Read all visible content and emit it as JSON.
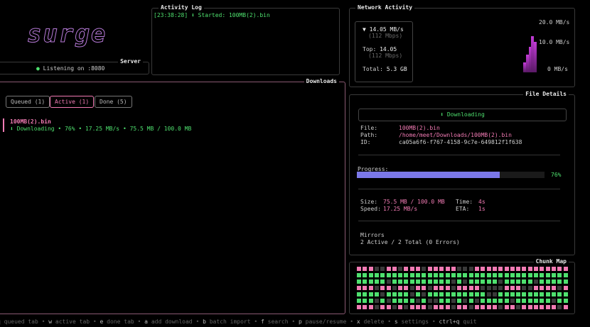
{
  "logo": {
    "text": "surge"
  },
  "server": {
    "title": "Server",
    "status": "Listening on :8080",
    "status_color": "#4ee06e"
  },
  "activity": {
    "title": "Activity Log",
    "entries": [
      {
        "time": "[23:38:28]",
        "message": "⬇ Started: 100MB(2).bin"
      }
    ]
  },
  "network": {
    "title": "Network Activity",
    "current_speed": "▼ 14.05 MB/s",
    "current_mbps": "(112 Mbps)",
    "top_label": "Top:",
    "top_value": "14.05",
    "top_mbps": "(112 Mbps)",
    "total_label": "Total:",
    "total_value": "5.3 GB",
    "axis": [
      "20.0 MB/s",
      "10.0 MB/s",
      "0 MB/s"
    ]
  },
  "chart_data": {
    "type": "area",
    "ylim": [
      0,
      20
    ],
    "y_unit": "MB/s",
    "values": [
      0,
      0,
      0,
      0,
      0,
      0,
      0,
      0,
      0,
      0,
      0,
      0,
      0,
      0,
      0,
      0,
      0,
      0,
      0,
      0,
      0,
      0,
      0,
      0,
      0,
      0,
      0,
      0,
      0,
      0,
      0,
      0,
      0,
      0,
      0,
      0,
      0,
      0,
      0,
      0,
      4,
      7,
      10,
      14.05,
      12
    ]
  },
  "downloads": {
    "title": "Downloads",
    "tabs": [
      {
        "label": "Queued (1)",
        "active": false
      },
      {
        "label": "Active (1)",
        "active": true
      },
      {
        "label": "Done (5)",
        "active": false
      }
    ],
    "items": [
      {
        "name": "100MB(2).bin",
        "status": "⬇ Downloading • 76% • 17.25 MB/s • 75.5 MB / 100.0 MB"
      }
    ]
  },
  "details": {
    "title": "File Details",
    "status": "⬇ Downloading",
    "file_label": "File:",
    "file": "100MB(2).bin",
    "path_label": "Path:",
    "path": "/home/meet/Downloads/100MB(2).bin",
    "id_label": "ID:",
    "id": "ca05a6f6-f767-4158-9c7e-649812f1f638",
    "progress_label": "Progress:",
    "progress": 0.76,
    "progress_text": "76%",
    "size_label": "Size:",
    "size": "75.5 MB / 100.0 MB",
    "time_label": "Time:",
    "time": "4s",
    "speed_label": "Speed:",
    "speed": "17.25 MB/s",
    "eta_label": "ETA:",
    "eta": "1s",
    "mirrors_label": "Mirrors",
    "mirrors": "2 Active / 2 Total (0 Errors)"
  },
  "chunkmap": {
    "title": "Chunk Map",
    "colors": {
      "done": "#4ee06e",
      "active": "#f27bb4",
      "pending": "#3a3a3a"
    },
    "rows": [
      "ppp..pp.ppp.ppppp...pppppppppppppppp",
      "gggggggggggggggggggggggggggggggggggg",
      "ggggg.gggggggggg.g.ggggg.ggggg.ggggg",
      "ppp.pp.pp.pp.ppp.pppp....ppp..pppp.p",
      "gggg.gggg.g.gggggggggg..gggggggggggg",
      "ggg.g.gggg.g..gg.g.g.ggggg.gggggg.gg",
      "ppp.pp.p.ppp.ppp.pp.pppp.pp.pppppp.p"
    ]
  },
  "footer": {
    "items": [
      {
        "key": "q",
        "label": "queued tab"
      },
      {
        "key": "w",
        "label": "active tab"
      },
      {
        "key": "e",
        "label": "done tab"
      },
      {
        "key": "a",
        "label": "add download"
      },
      {
        "key": "b",
        "label": "batch import"
      },
      {
        "key": "f",
        "label": "search"
      },
      {
        "key": "p",
        "label": "pause/resume"
      },
      {
        "key": "x",
        "label": "delete"
      },
      {
        "key": "s",
        "label": "settings"
      },
      {
        "key": "ctrl+q",
        "label": "quit"
      }
    ]
  }
}
